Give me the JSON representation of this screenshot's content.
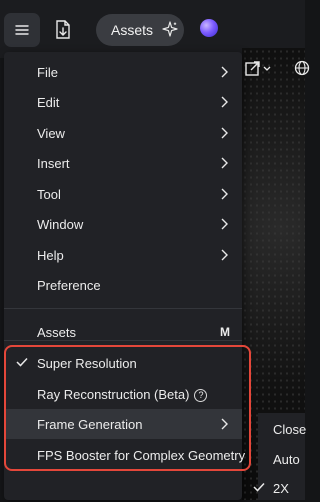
{
  "toolbar": {
    "assets_label": "Assets"
  },
  "menu": {
    "items": [
      {
        "label": "File",
        "has_submenu": true
      },
      {
        "label": "Edit",
        "has_submenu": true
      },
      {
        "label": "View",
        "has_submenu": true
      },
      {
        "label": "Insert",
        "has_submenu": true
      },
      {
        "label": "Tool",
        "has_submenu": true
      },
      {
        "label": "Window",
        "has_submenu": true
      },
      {
        "label": "Help",
        "has_submenu": true
      },
      {
        "label": "Preference",
        "has_submenu": false
      },
      {
        "label": "Assets",
        "shortcut": "M"
      },
      {
        "label": "Super Resolution",
        "checked": true
      },
      {
        "label": "Ray Reconstruction (Beta)",
        "info": "?"
      },
      {
        "label": "Frame Generation",
        "has_submenu": true,
        "highlighted": true
      },
      {
        "label": "FPS Booster for Complex Geometry"
      }
    ]
  },
  "submenu": {
    "items": [
      {
        "label": "Close",
        "checked": false
      },
      {
        "label": "Auto",
        "checked": false
      },
      {
        "label": "2X",
        "checked": true
      }
    ]
  },
  "colors": {
    "menu_bg": "#212226",
    "highlight_border": "#e4473a",
    "hover_bg": "#33353a"
  },
  "icons": [
    "hamburger-icon",
    "import-file-icon",
    "sparkle-icon",
    "chevron-right-icon",
    "check-icon",
    "info-icon",
    "export-icon",
    "globe-icon"
  ]
}
